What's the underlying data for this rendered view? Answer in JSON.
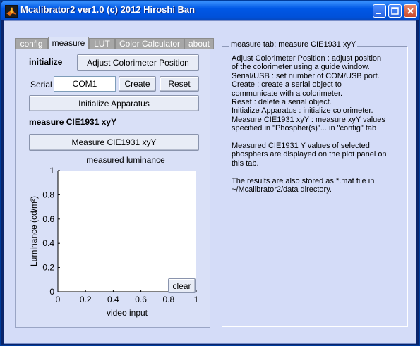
{
  "window": {
    "title": "Mcalibrator2 ver1.0 (c) 2012 Hiroshi Ban",
    "icon": "matlab-icon",
    "controls": [
      "minimize-icon",
      "maximize-icon",
      "close-icon"
    ]
  },
  "tabs": [
    {
      "label": "config",
      "active": false
    },
    {
      "label": "measure",
      "active": true
    },
    {
      "label": "LUT",
      "active": false
    },
    {
      "label": "Color Calculator",
      "active": false
    },
    {
      "label": "about",
      "active": false
    }
  ],
  "measure": {
    "initialize_heading": "initialize",
    "adjust_button": "Adjust Colorimeter Position",
    "serial_label": "Serial",
    "serial_value": "COM1",
    "create_button": "Create",
    "reset_button": "Reset",
    "init_apparatus_button": "Initialize Apparatus",
    "measure_heading": "measure CIE1931 xyY",
    "measure_button": "Measure CIE1931 xyY",
    "clear_button": "clear"
  },
  "chart_data": {
    "type": "line",
    "title": "measured luminance",
    "xlabel": "video input",
    "ylabel": "Luminance (cd/m²)",
    "xlim": [
      0,
      1
    ],
    "ylim": [
      0,
      1
    ],
    "xticks": [
      "0",
      "0.2",
      "0.4",
      "0.6",
      "0.8",
      "1"
    ],
    "yticks": [
      "0",
      "0.2",
      "0.4",
      "0.6",
      "0.8",
      "1"
    ],
    "series": []
  },
  "help": {
    "group_title": "measure tab: measure CIE1931 xyY",
    "text": "Adjust Colorimeter Position : adjust position\nof the colorimeter using a guide window.\nSerial/USB : set number of COM/USB port.\nCreate : create a serial object to\ncommunicate with a colorimeter.\nReset : delete a serial object.\nInitialize Apparatus : initialize colorimeter.\nMeasure CIE1931 xyY : measure xyY values\nspecified in \"Phospher(s)\"... in \"config\" tab\n\nMeasured CIE1931 Y values of selected\nphosphers are displayed on the plot panel on\nthis tab.\n\nThe results are also stored as *.mat file in\n~/Mcalibrator2/data directory."
  }
}
